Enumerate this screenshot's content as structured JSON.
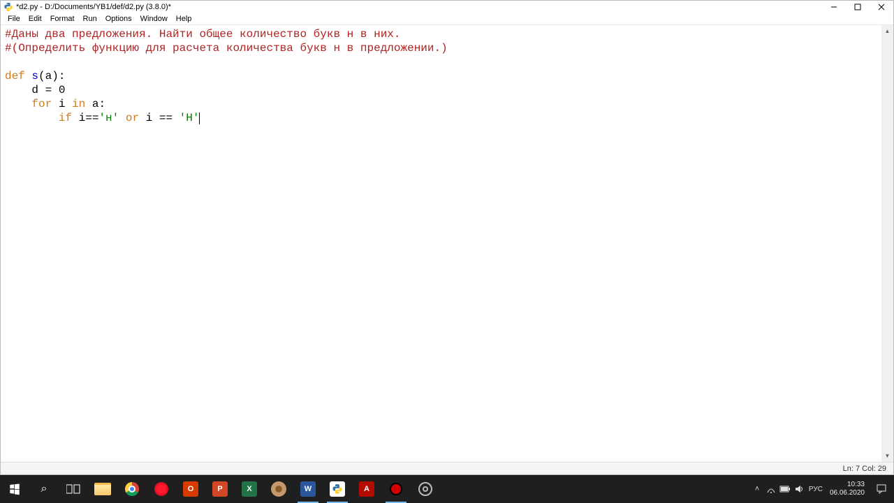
{
  "titlebar": {
    "text": "*d2.py - D:/Documents/YB1/def/d2.py (3.8.0)*"
  },
  "menu": {
    "items": [
      "File",
      "Edit",
      "Format",
      "Run",
      "Options",
      "Window",
      "Help"
    ]
  },
  "code": {
    "comment1": "#Даны два предложения. Найти общее количество букв н в них.",
    "comment2": "#(Определить функцию для расчета количества букв н в предложении.)",
    "kw_def": "def",
    "fn_name": " s",
    "fn_paren": "(a):",
    "indent1": "    d = 0",
    "kw_for": "for",
    "for_mid": " i ",
    "kw_in": "in",
    "for_tail": " a:",
    "kw_if": "if",
    "if_mid1": " i==",
    "str1": "'н'",
    "kw_or": "or",
    "if_mid2": " i == ",
    "str2": "'Н'"
  },
  "statusbar": {
    "text": "Ln: 7  Col: 29"
  },
  "taskbar": {
    "lang": "РУС",
    "time": "10:33",
    "date": "06.06.2020"
  }
}
